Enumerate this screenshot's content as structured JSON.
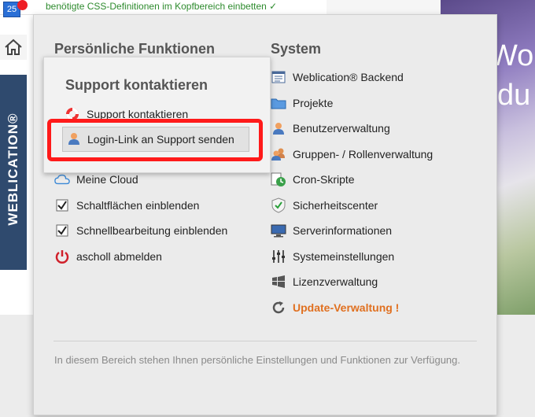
{
  "topbar": {
    "badge_count": "25",
    "message": "benötigte CSS-Definitionen im Kopfbereich einbetten ✓"
  },
  "brand": {
    "vertical_label": "WEBLICATION®"
  },
  "background_text": {
    "line1": "Woh",
    "line2": "du"
  },
  "panel": {
    "personal_title": "Persönliche Funktionen",
    "system_title": "System",
    "personal_items": [
      {
        "label": "Meine Cloud",
        "icon": "cloud-icon"
      },
      {
        "label": "Schaltflächen einblenden",
        "icon": "checkbox-checked-icon"
      },
      {
        "label": "Schnellbearbeitung einblenden",
        "icon": "checkbox-checked-icon"
      },
      {
        "label": "ascholl abmelden",
        "icon": "power-icon"
      }
    ],
    "system_items": [
      {
        "label": "Weblication® Backend",
        "icon": "backend-icon"
      },
      {
        "label": "Projekte",
        "icon": "folder-icon"
      },
      {
        "label": "Benutzerverwaltung",
        "icon": "user-icon"
      },
      {
        "label": "Gruppen- / Rollenverwaltung",
        "icon": "group-icon"
      },
      {
        "label": "Cron-Skripte",
        "icon": "cron-clock-icon"
      },
      {
        "label": "Sicherheitscenter",
        "icon": "shield-icon"
      },
      {
        "label": "Serverinformationen",
        "icon": "monitor-icon"
      },
      {
        "label": "Systemeinstellungen",
        "icon": "sliders-icon"
      },
      {
        "label": "Lizenzverwaltung",
        "icon": "license-icon"
      },
      {
        "label": "Update-Verwaltung !",
        "icon": "refresh-icon"
      }
    ],
    "footer": "In diesem Bereich stehen Ihnen persönliche Einstellungen und Funktionen zur Verfügung."
  },
  "popup": {
    "title": "Support kontaktieren",
    "item_contact": "Support kontaktieren",
    "item_login_link": "Login-Link an Support senden"
  },
  "colors": {
    "panel_bg": "#ebebeb",
    "warning": "#e07020",
    "highlight": "#ff1a1a",
    "brand_bar": "#2f4a6e"
  }
}
